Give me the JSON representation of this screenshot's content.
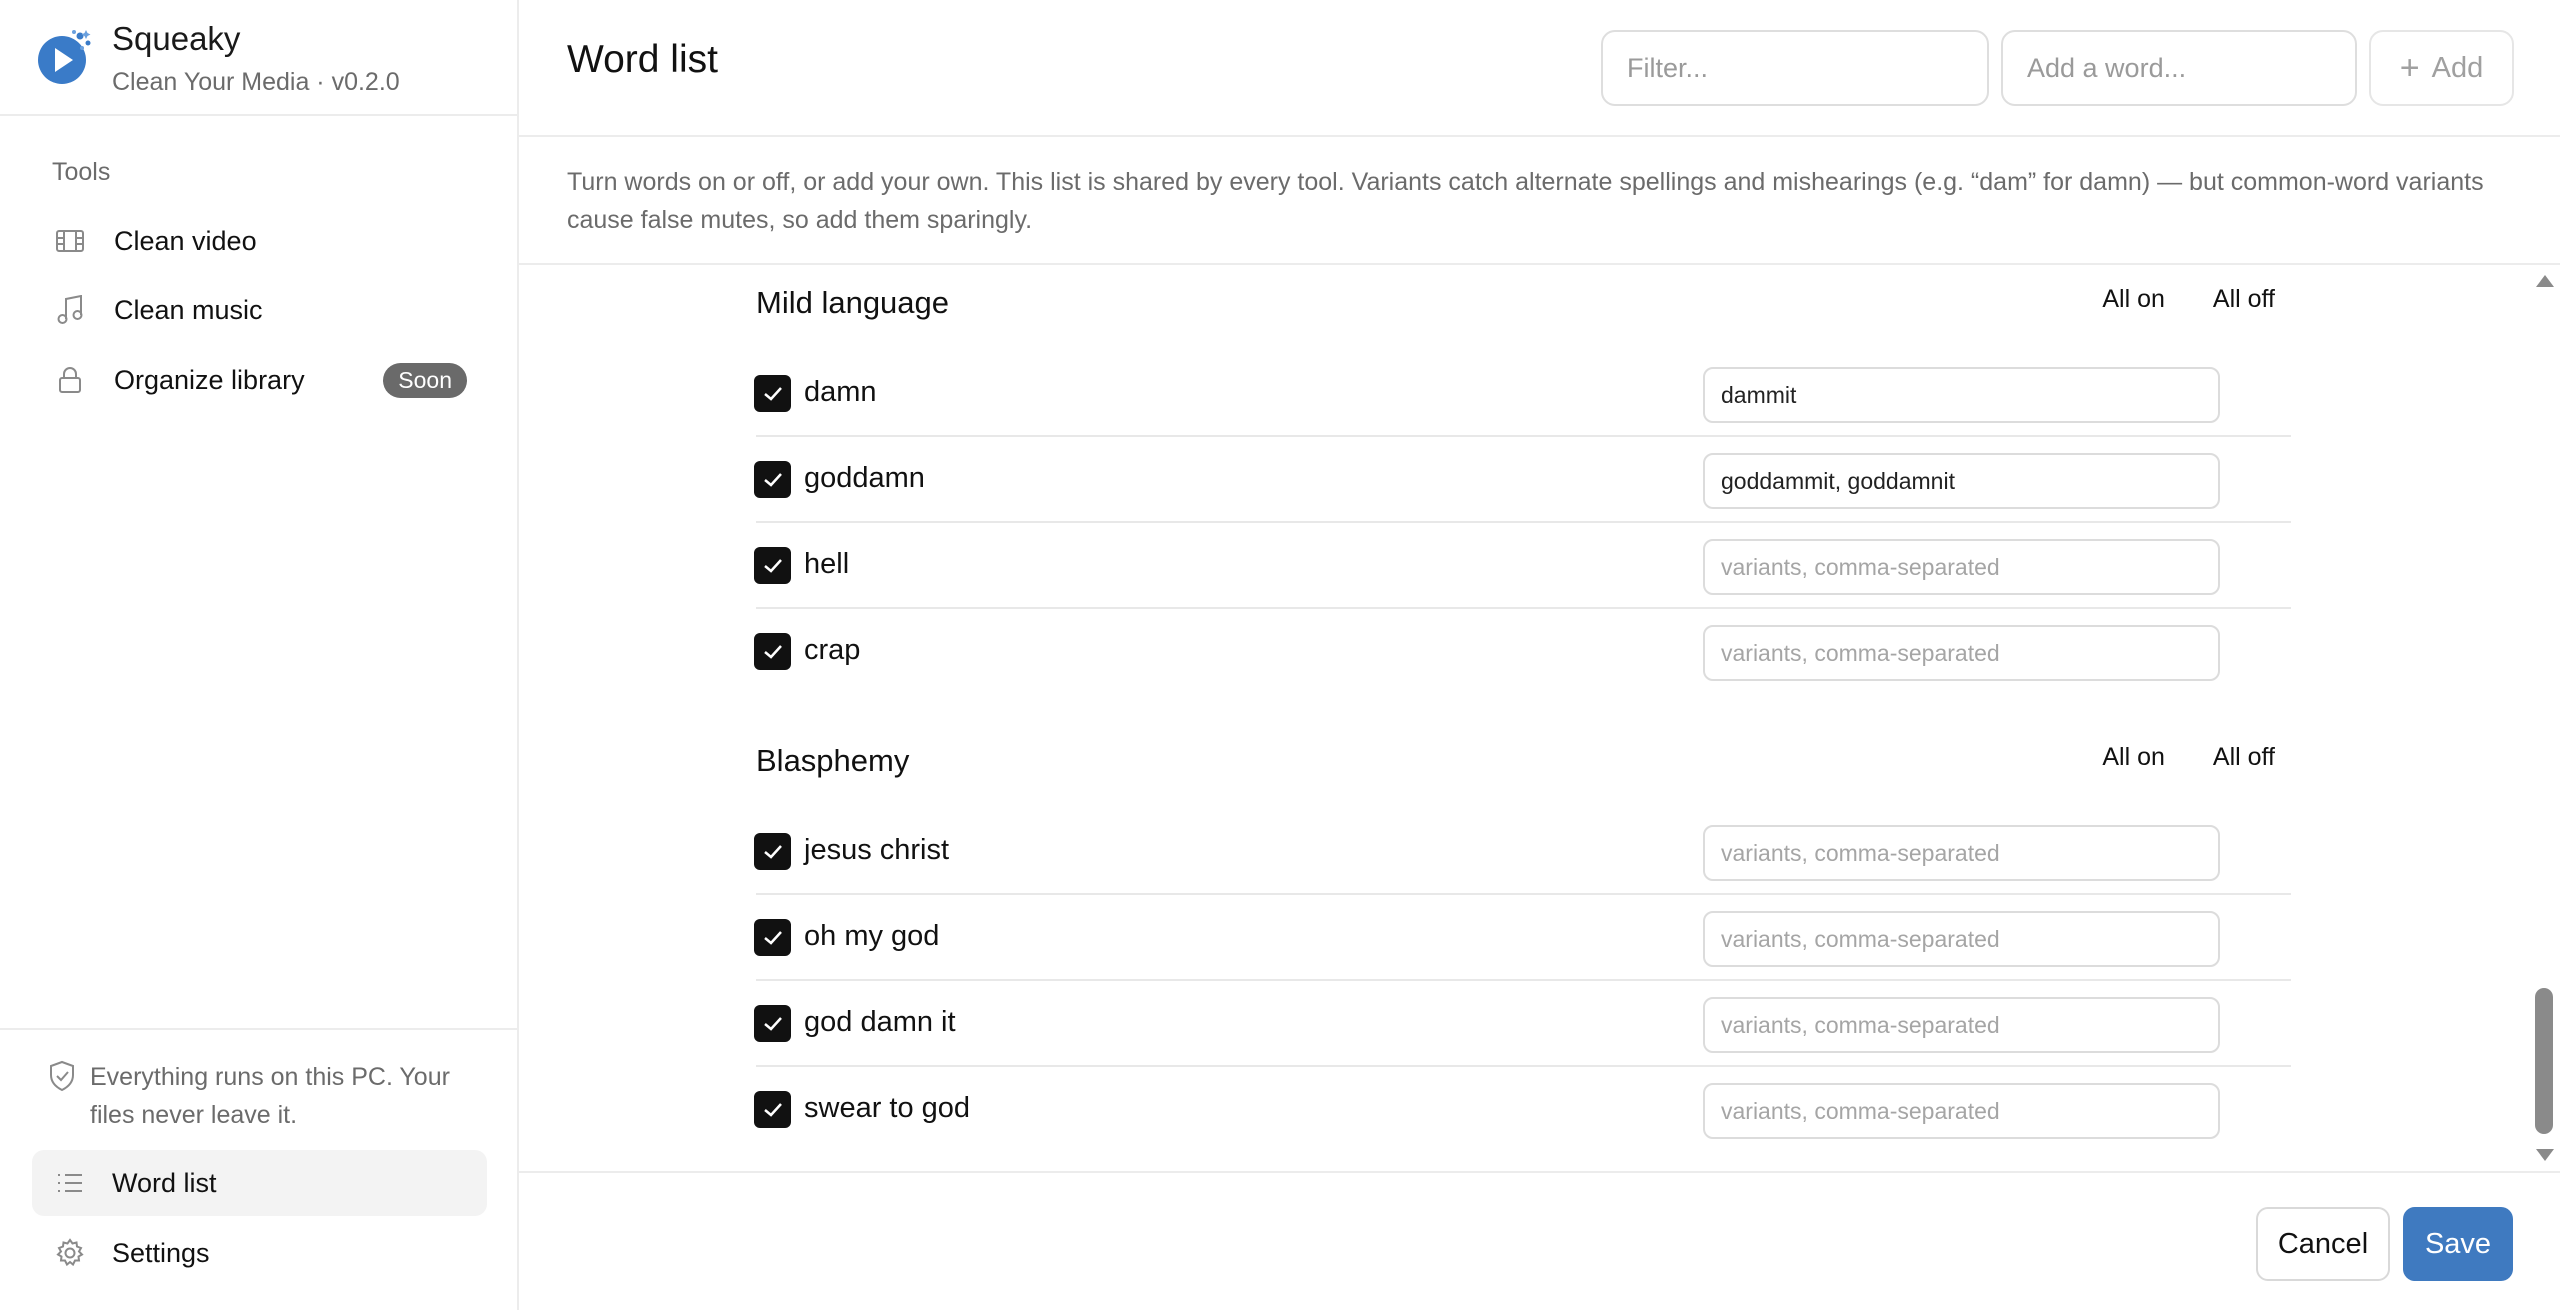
{
  "app": {
    "name": "Squeaky",
    "subtitle": "Clean Your Media · v0.2.0",
    "brand_color": "#3a7bc8"
  },
  "sidebar": {
    "tools_label": "Tools",
    "items": [
      {
        "label": "Clean video",
        "icon": "film-icon"
      },
      {
        "label": "Clean music",
        "icon": "music-note-icon"
      },
      {
        "label": "Organize library",
        "icon": "lock-icon",
        "badge": "Soon"
      }
    ],
    "privacy_note": "Everything runs on this PC. Your files never leave it.",
    "bottom_items": [
      {
        "label": "Word list",
        "icon": "list-icon",
        "active": true
      },
      {
        "label": "Settings",
        "icon": "gear-icon",
        "active": false
      }
    ]
  },
  "header": {
    "title": "Word list",
    "filter_placeholder": "Filter...",
    "add_word_placeholder": "Add a word...",
    "add_label": "Add"
  },
  "description": "Turn words on or off, or add your own. This list is shared by every tool. Variants catch alternate spellings and mishearings (e.g. “dam” for damn) — but common-word variants cause false mutes, so add them sparingly.",
  "variant_placeholder": "variants, comma-separated",
  "sections": [
    {
      "title": "Mild language",
      "all_on": "All on",
      "all_off": "All off",
      "words": [
        {
          "word": "damn",
          "enabled": true,
          "variants": "dammit"
        },
        {
          "word": "goddamn",
          "enabled": true,
          "variants": "goddammit, goddamnit"
        },
        {
          "word": "hell",
          "enabled": true,
          "variants": ""
        },
        {
          "word": "crap",
          "enabled": true,
          "variants": ""
        }
      ]
    },
    {
      "title": "Blasphemy",
      "all_on": "All on",
      "all_off": "All off",
      "words": [
        {
          "word": "jesus christ",
          "enabled": true,
          "variants": ""
        },
        {
          "word": "oh my god",
          "enabled": true,
          "variants": ""
        },
        {
          "word": "god damn it",
          "enabled": true,
          "variants": ""
        },
        {
          "word": "swear to god",
          "enabled": true,
          "variants": ""
        }
      ]
    }
  ],
  "footer": {
    "cancel_label": "Cancel",
    "save_label": "Save",
    "save_color": "#3f7ac0"
  }
}
